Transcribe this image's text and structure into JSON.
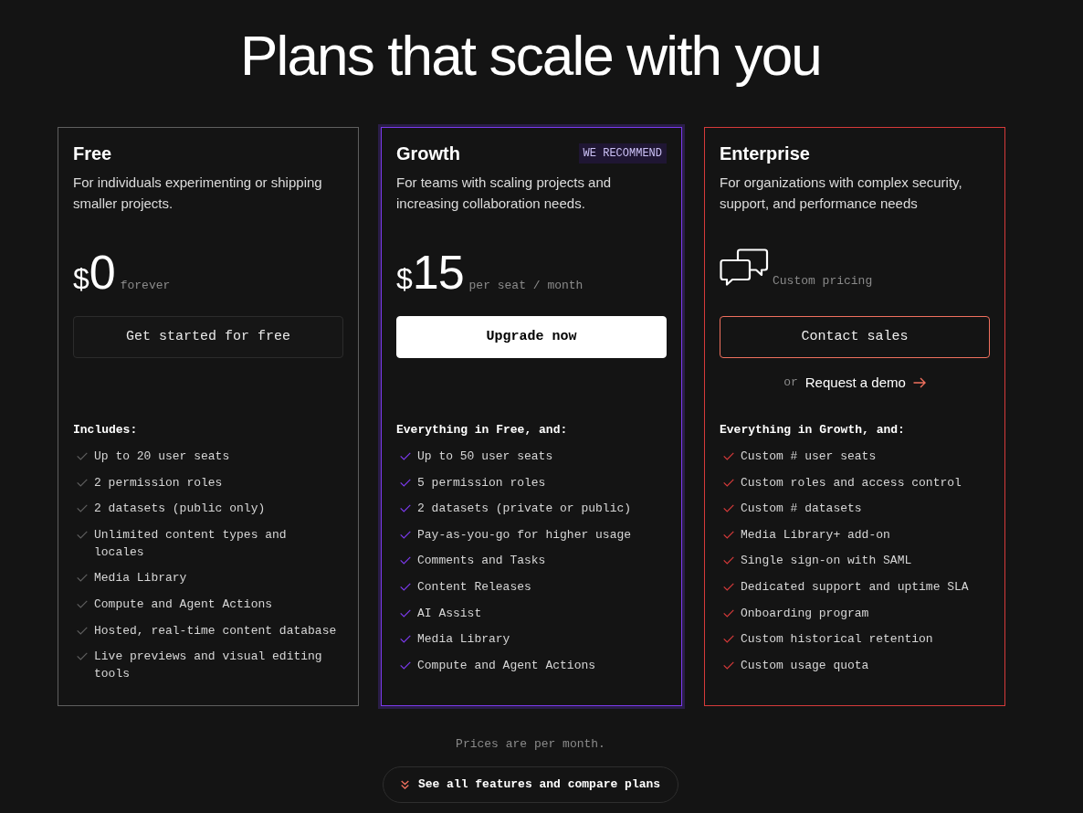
{
  "heading": "Plans that scale with you",
  "plans": [
    {
      "name": "Free",
      "color": "#5f5f5f",
      "highlighted": false,
      "description": "For individuals experimenting or shipping smaller projects.",
      "price": {
        "kind": "amount",
        "currency": "$",
        "amount": "0",
        "note": "forever"
      },
      "button": {
        "kind": "secondary",
        "label": "Get started for free"
      },
      "features_heading": "Includes:",
      "features": [
        "Up to 20 user seats",
        "2 permission roles",
        "2 datasets (public only)",
        "Unlimited content types and locales",
        "Media Library",
        "Compute and Agent Actions",
        "Hosted, real-time content database",
        "Live previews and visual editing tools"
      ]
    },
    {
      "name": "Growth",
      "color": "#7c3aed",
      "highlighted": true,
      "badge": "WE RECOMMEND",
      "description": "For teams with scaling projects and increasing collaboration needs.",
      "price": {
        "kind": "amount",
        "currency": "$",
        "amount": "15",
        "note": "per seat / month"
      },
      "button": {
        "kind": "primary",
        "label": "Upgrade now"
      },
      "features_heading": "Everything in Free, and:",
      "features": [
        "Up to 50 user seats",
        "5 permission roles",
        "2 datasets (private or public)",
        "Pay-as-you-go for higher usage",
        "Comments and Tasks",
        "Content Releases",
        "AI Assist",
        "Media Library",
        "Compute and Agent Actions"
      ]
    },
    {
      "name": "Enterprise",
      "color": "#d63a3a",
      "highlighted": false,
      "description": "For organizations with complex security, support, and performance needs",
      "price": {
        "kind": "custom",
        "note": "Custom pricing"
      },
      "button": {
        "kind": "outline",
        "label": "Contact sales"
      },
      "secondary_link": {
        "prefix": "or",
        "label": "Request a demo"
      },
      "features_heading": "Everything in Growth, and:",
      "features": [
        "Custom # user seats",
        "Custom roles and access control",
        "Custom # datasets",
        "Media Library+ add-on",
        "Single sign-on with SAML",
        "Dedicated support and uptime SLA",
        "Onboarding program",
        "Custom historical retention",
        "Custom usage quota"
      ]
    }
  ],
  "footer": {
    "note": "Prices are per month.",
    "compare_button": "See all features and compare plans"
  }
}
